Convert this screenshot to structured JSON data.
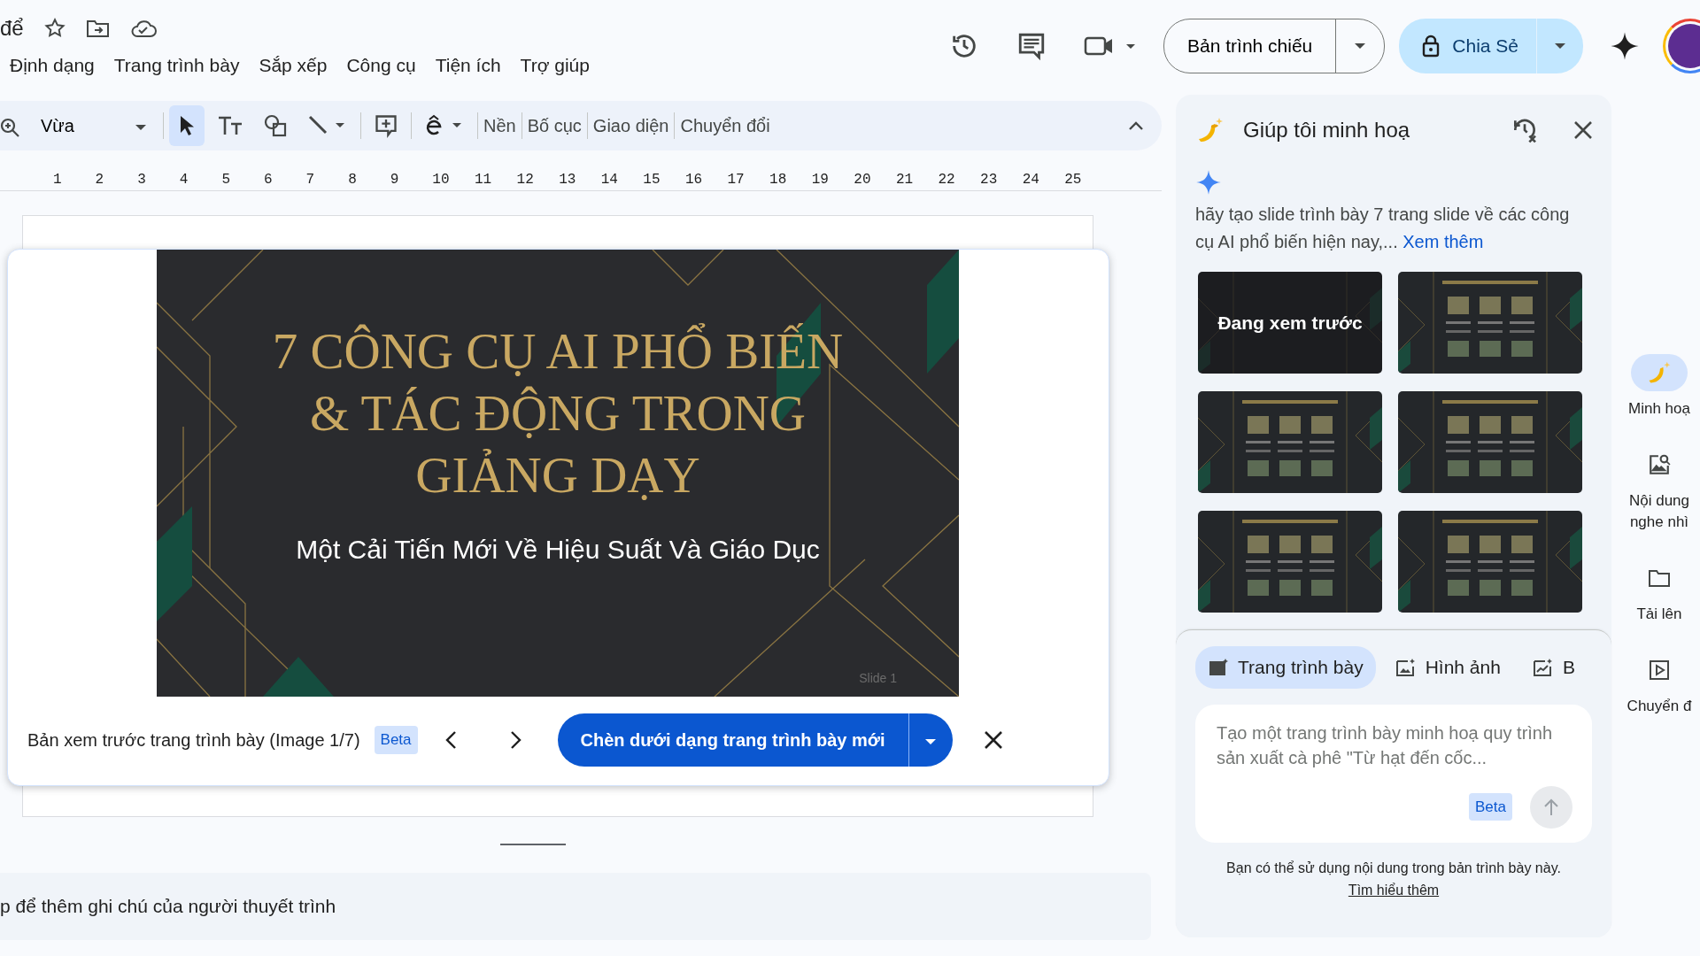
{
  "doc": {
    "title": "để"
  },
  "menu": [
    "Định dạng",
    "Trang trình bày",
    "Sắp xếp",
    "Công cụ",
    "Tiện ích",
    "Trợ giúp"
  ],
  "actions": {
    "slideshow": "Bản trình chiếu",
    "share": "Chia Sẻ"
  },
  "toolbar": {
    "zoom": "Vừa",
    "pointer_selected": true,
    "buttons": [
      "Nền",
      "Bố cục",
      "Giao diện",
      "Chuyển đổi"
    ]
  },
  "ruler": [
    "1",
    "2",
    "3",
    "4",
    "5",
    "6",
    "7",
    "8",
    "9",
    "10",
    "11",
    "12",
    "13",
    "14",
    "15",
    "16",
    "17",
    "18",
    "19",
    "20",
    "21",
    "22",
    "23",
    "24",
    "25"
  ],
  "slide": {
    "title": "7 CÔNG CỤ AI PHỔ BIẾN & TÁC ĐỘNG TRONG GIẢNG DẠY",
    "subtitle": "Một Cải Tiến Mới Về Hiệu Suất Và Giáo Dục",
    "footer": "Slide 1"
  },
  "preview_bar": {
    "label": "Bản xem trước trang trình bày (Image 1/7)",
    "badge": "Beta",
    "insert": "Chèn dưới dạng trang trình bày mới"
  },
  "notes": {
    "placeholder": "p để thêm ghi chú của người thuyết trình"
  },
  "panel": {
    "title": "Giúp tôi minh hoạ",
    "prompt": "hãy tạo slide trình bày 7 trang slide về các công cụ AI phổ biến hiện nay,...",
    "more_link": "Xem thêm",
    "thumbnails": [
      {
        "selected": true,
        "overlay": "Đang xem trước"
      },
      {
        "selected": false
      },
      {
        "selected": false
      },
      {
        "selected": false
      },
      {
        "selected": false
      },
      {
        "selected": false
      }
    ],
    "tabs": [
      {
        "label": "Trang trình bày",
        "selected": true
      },
      {
        "label": "Hình ảnh",
        "selected": false
      },
      {
        "label": "B",
        "selected": false
      }
    ],
    "input": {
      "placeholder": "Tạo một trang trình bày minh hoạ quy trình sản xuất cà phê \"Từ hạt đến cốc...",
      "badge": "Beta"
    },
    "footer": {
      "text": "Bạn có thể sử dụng nội dung trong bản trình bày này.",
      "link": "Tìm hiểu thêm"
    }
  },
  "side_tabs": [
    {
      "label": "Minh hoạ",
      "selected": true
    },
    {
      "label": "Nội dung nghe nhì",
      "selected": false
    },
    {
      "label": "Tải lên",
      "selected": false
    },
    {
      "label": "Chuyển đ",
      "selected": false
    }
  ]
}
